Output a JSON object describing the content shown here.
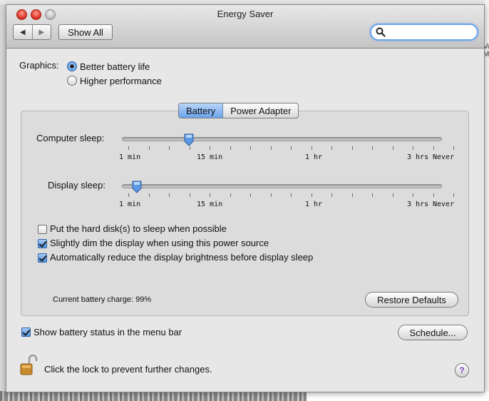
{
  "window": {
    "title": "Energy Saver"
  },
  "toolbar": {
    "back_icon": "back-arrow-icon",
    "forward_icon": "forward-arrow-icon",
    "show_all_label": "Show All",
    "search": {
      "value": "",
      "placeholder": ""
    }
  },
  "desktop": {
    "right_edge_text": "Va\nMa"
  },
  "graphics": {
    "label": "Graphics:",
    "options": [
      {
        "label": "Better battery life",
        "selected": true
      },
      {
        "label": "Higher performance",
        "selected": false
      }
    ]
  },
  "tabs": [
    {
      "label": "Battery",
      "active": true
    },
    {
      "label": "Power Adapter",
      "active": false
    }
  ],
  "sliders": {
    "computer_sleep": {
      "label": "Computer sleep:",
      "value_minutes": 10
    },
    "display_sleep": {
      "label": "Display sleep:",
      "value_minutes": 2
    },
    "tick_labels": [
      "1 min",
      "15 min",
      "1 hr",
      "3 hrs",
      "Never"
    ]
  },
  "checkboxes": [
    {
      "label": "Put the hard disk(s) to sleep when possible",
      "checked": false
    },
    {
      "label": "Slightly dim the display when using this power source",
      "checked": true
    },
    {
      "label": "Automatically reduce the display brightness before display sleep",
      "checked": true
    }
  ],
  "status": {
    "battery_charge": "Current battery charge: 99%"
  },
  "buttons": {
    "restore_defaults": "Restore Defaults",
    "schedule": "Schedule..."
  },
  "menu_bar_option": {
    "label": "Show battery status in the menu bar",
    "checked": true
  },
  "lock": {
    "text": "Click the lock to prevent further changes.",
    "icon": "unlocked-padlock-icon"
  },
  "help": {
    "label": "?"
  },
  "colors": {
    "accent": "#4d8fe0",
    "close": "#d8291c"
  }
}
